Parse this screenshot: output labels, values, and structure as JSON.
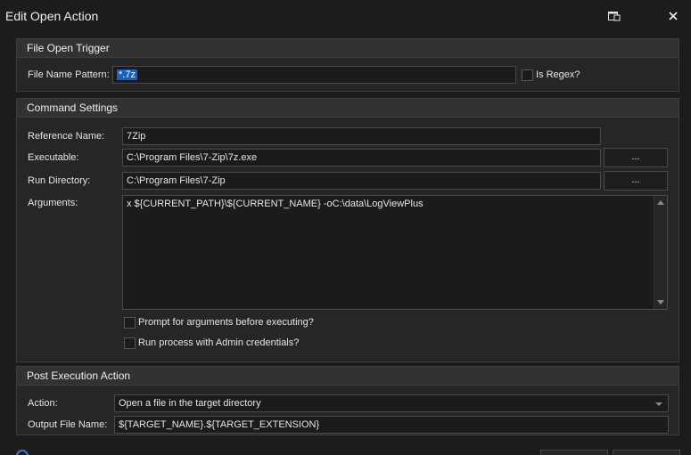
{
  "window": {
    "title": "Edit Open Action",
    "restore_icon": "window-restore-icon",
    "close_glyph": "×"
  },
  "file_open_trigger": {
    "header": "File Open Trigger",
    "pattern_label": "File Name Pattern:",
    "pattern_value": "*.7z",
    "regex_label": "Is Regex?",
    "regex_checked": false
  },
  "command_settings": {
    "header": "Command Settings",
    "reference_label": "Reference Name:",
    "reference_value": "7Zip",
    "executable_label": "Executable:",
    "executable_value": "C:\\Program Files\\7-Zip\\7z.exe",
    "rundir_label": "Run Directory:",
    "rundir_value": "C:\\Program Files\\7-Zip",
    "browse_label": "...",
    "arguments_label": "Arguments:",
    "arguments_value": "x ${CURRENT_PATH}\\${CURRENT_NAME} -oC:\\data\\LogViewPlus",
    "prompt_label": "Prompt for arguments before executing?",
    "prompt_checked": false,
    "admin_label": "Run process with Admin credentials?",
    "admin_checked": false
  },
  "post_execution": {
    "header": "Post Execution Action",
    "action_label": "Action:",
    "action_value": "Open a file in the target directory",
    "output_label": "Output File Name:",
    "output_value": "${TARGET_NAME}.${TARGET_EXTENSION}"
  },
  "colors": {
    "background": "#1c1c1c",
    "panel": "#262626",
    "selection": "#1b5fc4"
  }
}
